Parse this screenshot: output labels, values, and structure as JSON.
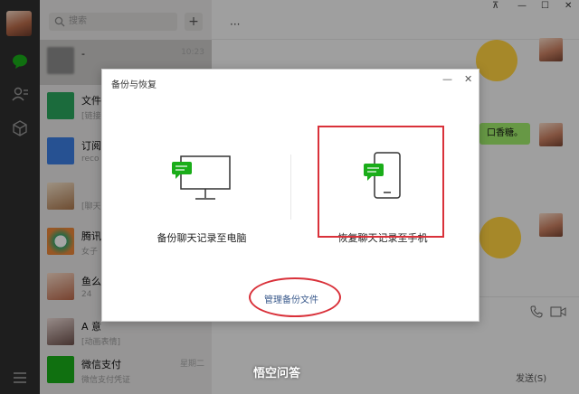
{
  "sidebar": {
    "icons": [
      "chat-icon",
      "contacts-icon",
      "favorites-icon",
      "menu-icon"
    ],
    "accent": "#1aad19"
  },
  "search": {
    "placeholder": "搜索",
    "add_label": "+"
  },
  "chats": [
    {
      "name": "-",
      "preview": "",
      "time": "10:23"
    },
    {
      "name": "文件",
      "preview": "[链接",
      "time": ""
    },
    {
      "name": "订阅",
      "preview": "reco",
      "time": ""
    },
    {
      "name": "",
      "preview": "[聊天",
      "time": ""
    },
    {
      "name": "腾讯",
      "preview": "女子",
      "time": ""
    },
    {
      "name": "鱼么",
      "preview": "24",
      "time": ""
    },
    {
      "name": "A 意",
      "preview": "[动画表情]",
      "time": ""
    },
    {
      "name": "微信支付",
      "preview": "微信支付凭证",
      "time": "星期二"
    }
  ],
  "chat": {
    "window_controls": [
      "⊼",
      "—",
      "☐",
      "✕"
    ],
    "more": "···",
    "bubble_text": "口香糖。",
    "send_label": "发送(S)",
    "watermark": "悟空问答"
  },
  "dialog": {
    "title": "备份与恢复",
    "minimize": "—",
    "close": "✕",
    "backup_label": "备份聊天记录至电脑",
    "restore_label": "恢复聊天记录至手机",
    "manage_label": "管理备份文件",
    "highlight_color": "#d9313a"
  }
}
